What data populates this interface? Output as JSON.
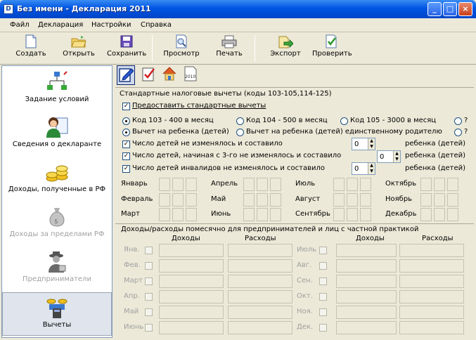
{
  "window": {
    "title": "Без имени - Декларация 2011",
    "icon": "D",
    "minimize": "_",
    "maximize": "□",
    "close": "×"
  },
  "menu": [
    "Файл",
    "Декларация",
    "Настройки",
    "Справка"
  ],
  "toolbar": {
    "create": "Создать",
    "open": "Открыть",
    "save": "Сохранить",
    "preview": "Просмотр",
    "print": "Печать",
    "export": "Экспорт",
    "check": "Проверить"
  },
  "sidebar": {
    "conditions": "Задание условий",
    "declarant": "Сведения о декларанте",
    "income_rf": "Доходы, полученные в РФ",
    "income_abroad": "Доходы за пределами РФ",
    "entrepreneurs": "Предприниматели",
    "deductions": "Вычеты"
  },
  "tabs": {
    "tab4_label": "2010"
  },
  "std": {
    "title": "Стандартные налоговые вычеты (коды 103-105,114-125)",
    "provide": "Предоставить стандартные вычеты",
    "code103": "Код 103 - 400 в месяц",
    "code104": "Код 104 - 500 в месяц",
    "code105": "Код 105 - 3000 в месяц",
    "q": "?",
    "child": "Вычет на ребенка (детей)",
    "child_single": "Вычет на ребенка (детей) единственному родителю",
    "row1": "Число детей не изменялось и составило",
    "row2": "Число детей, начиная с 3-го не изменялось и составило",
    "row3": "Число детей инвалидов не изменялось и составило",
    "val1": "0",
    "val2": "0",
    "val3": "0",
    "unit": "ребенка (детей)",
    "months": {
      "jan": "Январь",
      "feb": "Февраль",
      "mar": "Март",
      "apr": "Апрель",
      "may": "Май",
      "jun": "Июнь",
      "jul": "Июль",
      "aug": "Август",
      "sep": "Сентябрь",
      "oct": "Октябрь",
      "nov": "Ноябрь",
      "dec": "Декабрь"
    }
  },
  "ent": {
    "title": "Доходы/расходы помесячно для предпринимателей и лиц с частной практикой",
    "income": "Доходы",
    "expense": "Расходы",
    "left": [
      "Янв.",
      "Фев.",
      "Март",
      "Апр.",
      "Май",
      "Июнь"
    ],
    "right": [
      "Июль",
      "Авг.",
      "Сен.",
      "Окт.",
      "Ноя.",
      "Дек."
    ]
  }
}
